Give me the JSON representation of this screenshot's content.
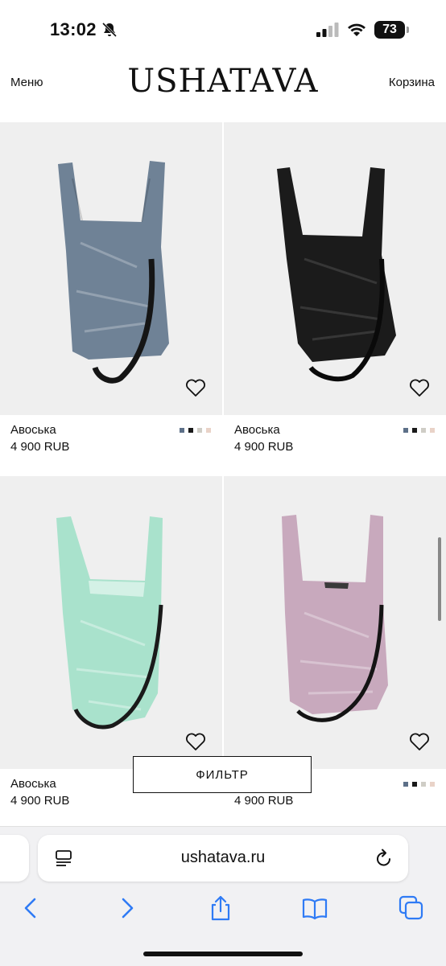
{
  "status_bar": {
    "time": "13:02",
    "battery": "73"
  },
  "header": {
    "menu": "Меню",
    "logo": "USHATAVA",
    "cart": "Корзина"
  },
  "products": [
    {
      "name": "Авоська",
      "price": "4 900 RUB",
      "bag_color": "#6f8296",
      "swatches": [
        "#5d7088",
        "#1a1a1a",
        "#cfcdc6",
        "#e9d3c8"
      ]
    },
    {
      "name": "Авоська",
      "price": "4 900 RUB",
      "bag_color": "#1b1b1b",
      "swatches": [
        "#5d7088",
        "#1a1a1a",
        "#cfcdc6",
        "#e9d3c8"
      ]
    },
    {
      "name": "Авоська",
      "price": "4 900 RUB",
      "bag_color": "#a9e2cc",
      "swatches": []
    },
    {
      "name": "",
      "price": "4 900 RUB",
      "bag_color": "#c8a9bd",
      "swatches": [
        "#5d7088",
        "#1a1a1a",
        "#cfcdc6",
        "#e9d3c8"
      ]
    }
  ],
  "filter_button": "ФИЛЬТР",
  "browser": {
    "url": "ushatava.ru"
  }
}
